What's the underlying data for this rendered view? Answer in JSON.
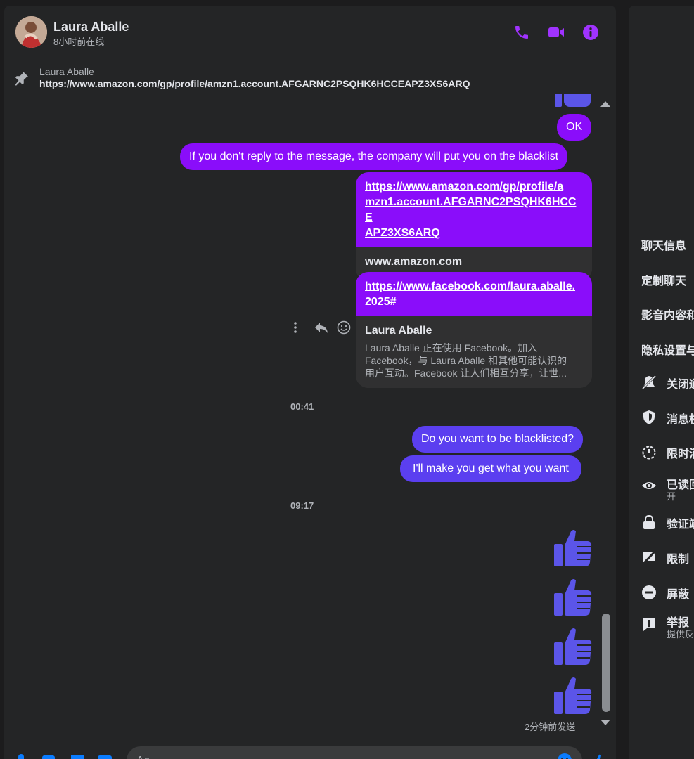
{
  "header": {
    "name": "Laura Aballe",
    "status": "8小时前在线",
    "icons": [
      "phone-icon",
      "video-icon",
      "info-icon"
    ]
  },
  "pinned": {
    "name": "Laura Aballe",
    "link": "https://www.amazon.com/gp/profile/amzn1.account.AFGARNC2PSQHK6HCCEAPZ3XS6ARQ"
  },
  "messages": {
    "ok": "OK",
    "blacklist_warning": "If you don't reply to the message, the company will put you on the blacklist",
    "amazon_card": {
      "url": "https://www.amazon.com/gp/profile/amzn1.account.AFGARNC2PSQHK6HCCEAPZ3XS6ARQ",
      "url_lines": [
        "https://www.amazon.com/gp/profile/a",
        "mzn1.account.AFGARNC2PSQHK6HCCE",
        "APZ3XS6ARQ"
      ],
      "domain": "www.amazon.com"
    },
    "facebook_card": {
      "url_lines": [
        "https://www.facebook.com/laura.aballe.",
        "2025#"
      ],
      "title": "Laura Aballe",
      "desc_lines": [
        "Laura Aballe 正在使用 Facebook。加入",
        "Facebook，与 Laura Aballe 和其他可能认识的",
        "用户互动。Facebook 让人们相互分享，让世..."
      ]
    },
    "time1": "00:41",
    "question": "Do you want to be blacklisted?",
    "promise": "I'll make you get what you want",
    "time2": "09:17",
    "sent_status": "2分钟前发送"
  },
  "composer": {
    "placeholder": "Aa",
    "icons": [
      "microphone-icon",
      "photo-icon",
      "sticker-icon",
      "gif-icon",
      "emoji-icon",
      "like-icon"
    ]
  },
  "right_panel": {
    "sections": [
      "聊天信息",
      "定制聊天",
      "影音内容和",
      "隐私设置与"
    ],
    "items": [
      {
        "label": "关闭通",
        "sub": ""
      },
      {
        "label": "消息权",
        "sub": ""
      },
      {
        "label": "限时消",
        "sub": ""
      },
      {
        "label": "已读回",
        "sub": "开"
      },
      {
        "label": "验证端",
        "sub": ""
      },
      {
        "label": "限制",
        "sub": ""
      },
      {
        "label": "屏蔽",
        "sub": ""
      },
      {
        "label": "举报",
        "sub": "提供反"
      }
    ]
  },
  "colors": {
    "accent_purple": "#8a0dfa",
    "accent_blue": "#5b3ff0",
    "icon_purple": "#a033ff",
    "background": "#242526"
  }
}
